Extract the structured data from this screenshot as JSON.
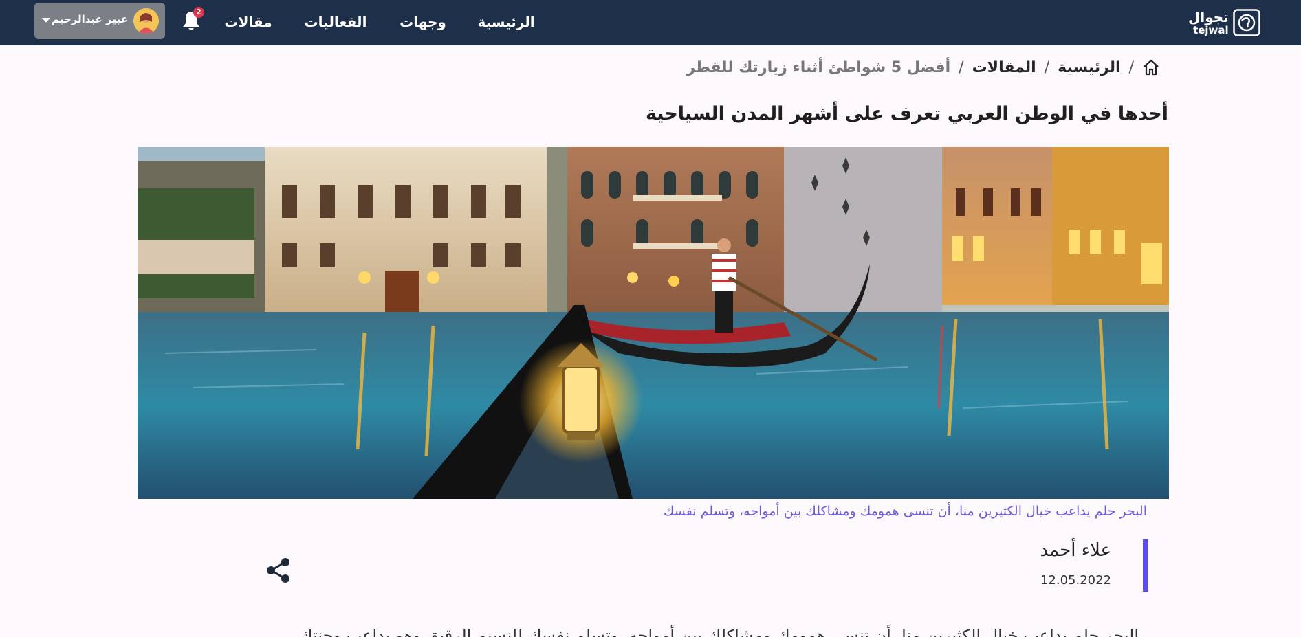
{
  "nav": {
    "logo_ar": "تجوال",
    "logo_en": "tejwal",
    "links": [
      {
        "label": "الرئيسية"
      },
      {
        "label": "وجهات"
      },
      {
        "label": "الفعاليات"
      },
      {
        "label": "مقالات"
      }
    ],
    "notifications_count": "2",
    "user_name": "عبير عبدالرحيم"
  },
  "breadcrumb": {
    "home": "الرئيسية",
    "section": "المقالات",
    "current": "أفضل 5 شواطئ أثناء زيارتك للقطر",
    "separator": "/"
  },
  "article": {
    "title": "أحدها في الوطن العربي تعرف على أشهر المدن السياحية",
    "image_caption": "البحر حلم يداعب خيال الكثيرين منا، أن تنسى همومك ومشاكلك بين أمواجه، وتسلم نفسك",
    "author": "علاء أحمد",
    "date": "12.05.2022",
    "body_first_line": "البحر حلم يداعب خيال الكثيرين منا، أن تنسى همومك ومشاكلك بين أمواجه، وتسلم نفسك للنسيم الرقيق وهو يداعب وجنتك"
  },
  "colors": {
    "nav_bg": "#1e3049",
    "accent": "#5b4cf0",
    "caption": "#6b5bd6",
    "badge": "#e0324b"
  },
  "icons": [
    "home-icon",
    "bell-icon",
    "chevron-down-icon",
    "share-icon",
    "logo-globe-icon"
  ]
}
